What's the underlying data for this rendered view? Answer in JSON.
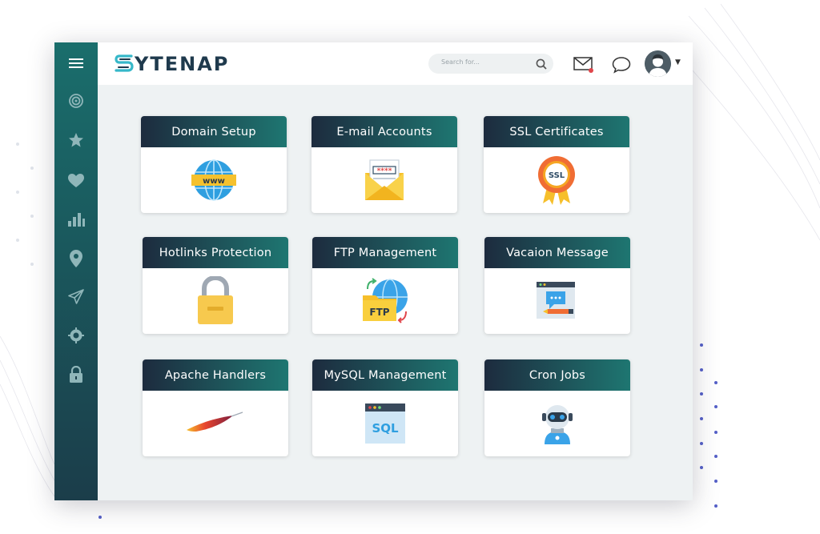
{
  "brand": {
    "logo_text": "YTENAP",
    "logo_mark": "S"
  },
  "search": {
    "placeholder": "Search for..."
  },
  "sidebar": {
    "items": [
      {
        "name": "menu-icon"
      },
      {
        "name": "target-icon"
      },
      {
        "name": "star-icon"
      },
      {
        "name": "heart-icon"
      },
      {
        "name": "bar-chart-icon"
      },
      {
        "name": "location-pin-icon"
      },
      {
        "name": "send-icon"
      },
      {
        "name": "settings-icon"
      },
      {
        "name": "lock-icon"
      }
    ]
  },
  "cards": [
    {
      "title": "Domain Setup",
      "icon": "www-globe-icon"
    },
    {
      "title": "E-mail Accounts",
      "icon": "envelope-password-icon"
    },
    {
      "title": "SSL Certificates",
      "icon": "ssl-badge-icon"
    },
    {
      "title": "Hotlinks Protection",
      "icon": "padlock-icon"
    },
    {
      "title": "FTP Management",
      "icon": "ftp-folder-icon"
    },
    {
      "title": "Vacaion Message",
      "icon": "message-window-icon"
    },
    {
      "title": "Apache Handlers",
      "icon": "apache-feather-icon"
    },
    {
      "title": "MySQL Management",
      "icon": "sql-file-icon"
    },
    {
      "title": "Cron Jobs",
      "icon": "robot-headset-icon"
    }
  ],
  "colors": {
    "sidebar_top": "#1a6e6c",
    "sidebar_bottom": "#1b3d4a",
    "card_header_start": "#1d2b3e",
    "card_header_end": "#1e7671",
    "notification_dot": "#e0464b"
  }
}
